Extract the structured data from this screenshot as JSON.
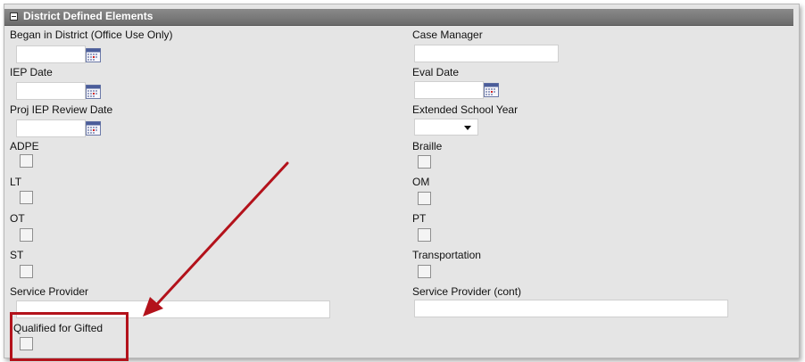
{
  "section": {
    "title": "District Defined Elements"
  },
  "fields": {
    "began_in_district": {
      "label": "Began in District (Office Use Only)",
      "value": ""
    },
    "case_manager": {
      "label": "Case Manager",
      "value": ""
    },
    "iep_date": {
      "label": "IEP Date",
      "value": ""
    },
    "eval_date": {
      "label": "Eval Date",
      "value": ""
    },
    "proj_iep_review_date": {
      "label": "Proj IEP Review Date",
      "value": ""
    },
    "extended_school_year": {
      "label": "Extended School Year",
      "value": ""
    },
    "adpe": {
      "label": "ADPE",
      "checked": false
    },
    "braille": {
      "label": "Braille",
      "checked": false
    },
    "lt": {
      "label": "LT",
      "checked": false
    },
    "om": {
      "label": "OM",
      "checked": false
    },
    "ot": {
      "label": "OT",
      "checked": false
    },
    "pt": {
      "label": "PT",
      "checked": false
    },
    "st": {
      "label": "ST",
      "checked": false
    },
    "transportation": {
      "label": "Transportation",
      "checked": false
    },
    "service_provider": {
      "label": "Service Provider",
      "value": ""
    },
    "service_provider_cont": {
      "label": "Service Provider (cont)",
      "value": ""
    },
    "qualified_for_gifted": {
      "label": "Qualified for Gifted",
      "checked": false
    }
  },
  "annotation": {
    "color": "#b3121b"
  },
  "icons": {
    "date_picker": "calendar-icon",
    "dropdown": "chevron-down-icon",
    "toggle": "collapse-icon"
  }
}
